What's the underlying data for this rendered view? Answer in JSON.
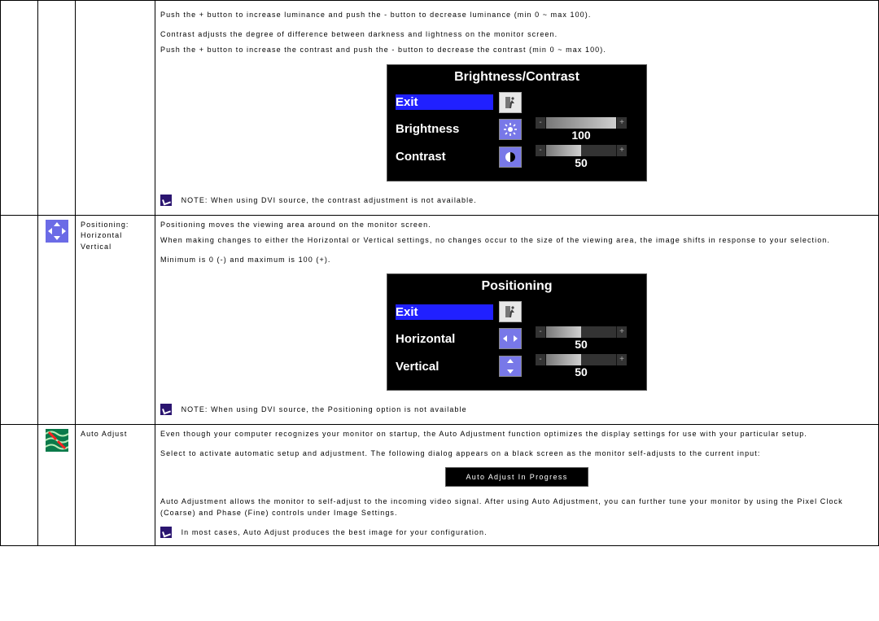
{
  "section_brightness": {
    "para1": "Push the + button to increase luminance and push the - button to decrease luminance (min 0 ~ max 100).",
    "para2": "Contrast adjusts the degree of difference between darkness and lightness on the monitor screen.",
    "para3": "Push the + button to increase the contrast and push the - button to decrease the contrast (min 0 ~ max 100).",
    "note": "NOTE: When using DVI source, the contrast adjustment is not available.",
    "osd": {
      "title": "Brightness/Contrast",
      "exit": "Exit",
      "rows": [
        {
          "label": "Brightness",
          "value": "100",
          "fill_pct": 100
        },
        {
          "label": "Contrast",
          "value": "50",
          "fill_pct": 50
        }
      ]
    }
  },
  "section_positioning": {
    "label_title": "Positioning:",
    "label_h": "Horizontal",
    "label_v": "Vertical",
    "para1": "Positioning moves the viewing area around on the monitor screen.",
    "para2": "When making changes to either the Horizontal or Vertical settings, no changes occur to the size of the viewing area, the image shifts  in response to your selection.",
    "para3": "Minimum is 0 (-) and maximum is 100 (+).",
    "note": "NOTE: When using DVI source, the Positioning option is not available",
    "osd": {
      "title": "Positioning",
      "exit": "Exit",
      "rows": [
        {
          "label": "Horizontal",
          "value": "50",
          "fill_pct": 50
        },
        {
          "label": "Vertical",
          "value": "50",
          "fill_pct": 50
        }
      ]
    }
  },
  "section_autoadjust": {
    "label": "Auto Adjust",
    "para1": "Even though your computer recognizes your monitor on startup, the Auto Adjustment function optimizes the display settings for use with your particular setup.",
    "para2": "Select to activate automatic setup and adjustment. The following dialog appears on a black screen as the monitor self-adjusts to the current input:",
    "dialog": "Auto Adjust In Progress",
    "para3": "Auto Adjustment allows the monitor to self-adjust to the incoming video signal. After using Auto Adjustment, you can further tune your monitor by using the Pixel Clock (Coarse) and Phase (Fine) controls under Image Settings.",
    "note": "In most cases, Auto Adjust produces the best image for your configuration."
  }
}
